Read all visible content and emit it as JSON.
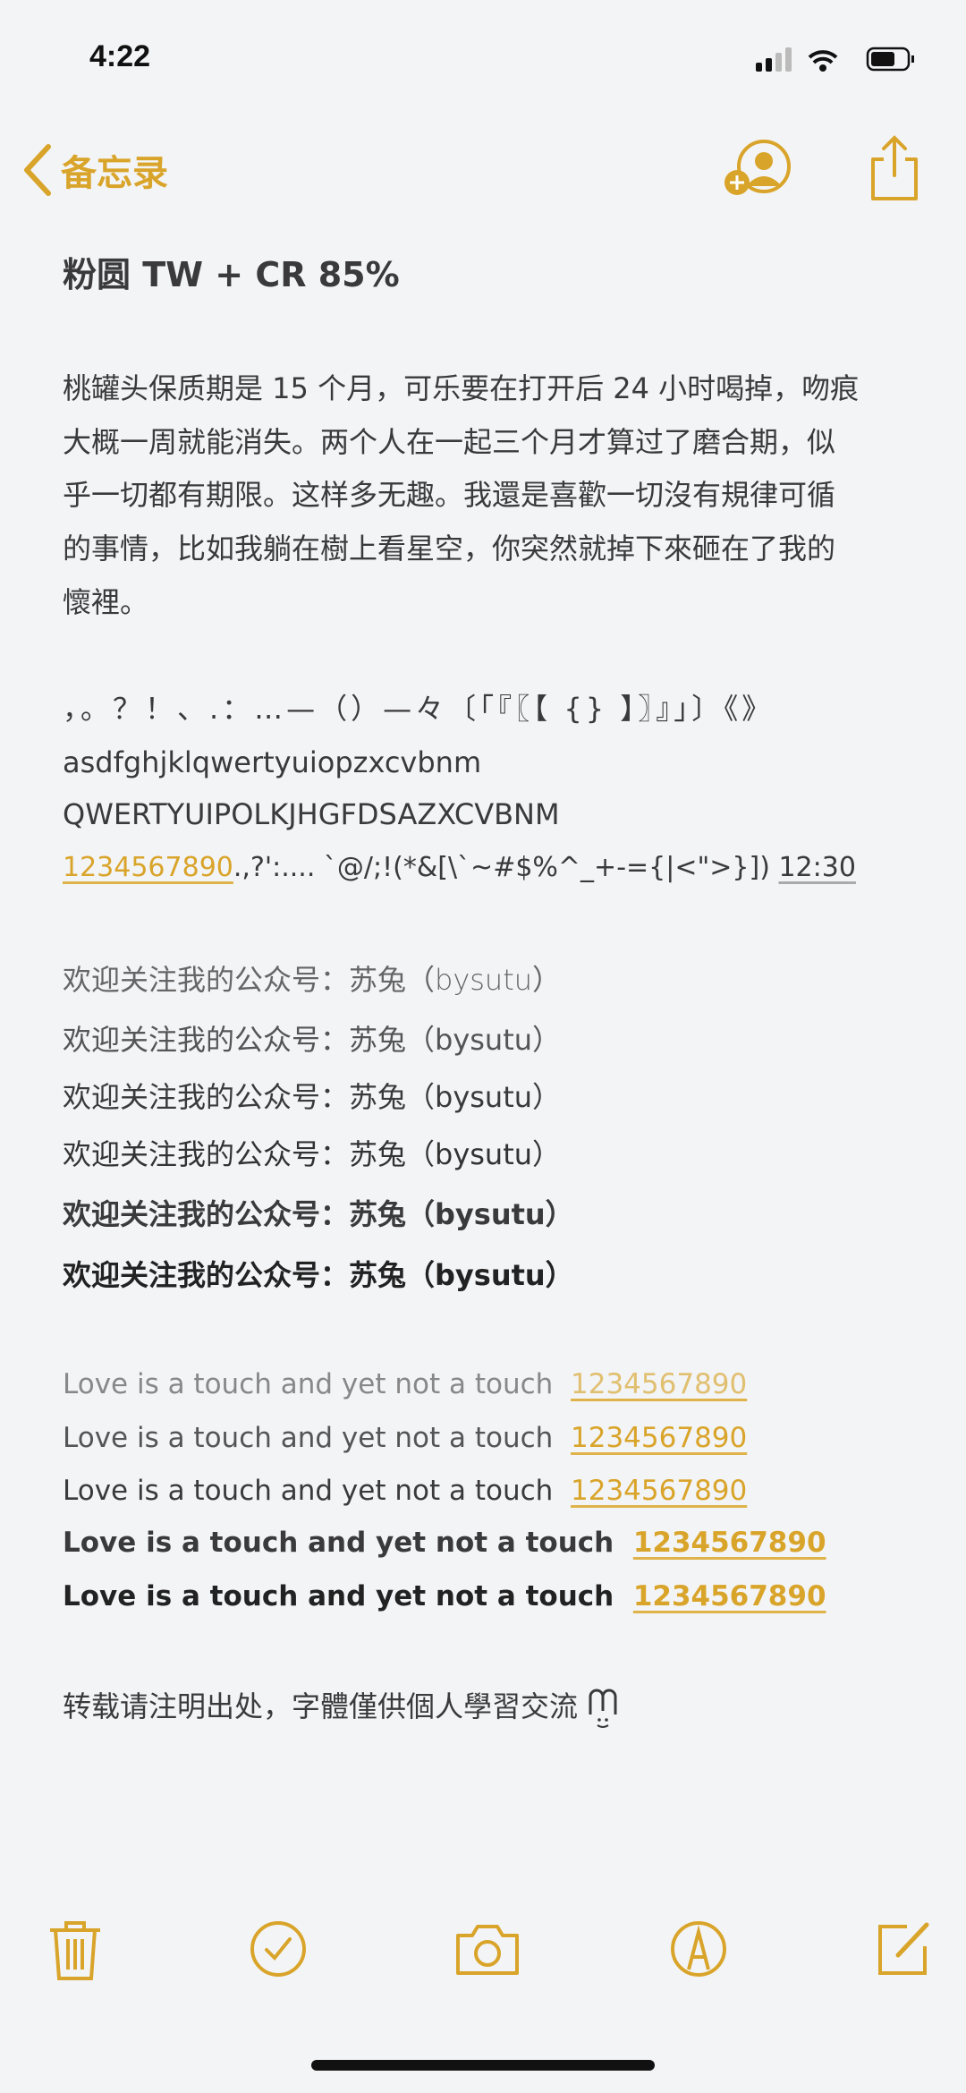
{
  "status_bar": {
    "time": "4:22"
  },
  "nav": {
    "back_label": "备忘录",
    "icons": [
      "chevron-left-icon",
      "add-person-icon",
      "share-icon"
    ]
  },
  "note": {
    "title": "粉圆 TW + CR 85%",
    "paragraph": [
      "桃罐头保质期是 15 个月，可乐要在打开后 24 小时喝掉，吻痕",
      "大概一周就能消失。两个人在一起三个月才算过了磨合期，似",
      "乎一切都有期限。这样多无趣。我還是喜歡一切沒有規律可循",
      "的事情，比如我躺在樹上看星空，你突然就掉下來砸在了我的",
      "懷裡。"
    ],
    "punctuation": "，。？！、.：…—（）—々〔「『〖【 {} 】〗』」〕《》",
    "lowercase": "asdfghjklqwertyuiopzxcvbnm",
    "uppercase": "QWERTYUIPOLKJHGFDSAZXCVBNM",
    "digits_link": "1234567890",
    "symbols": ".,?':.... `@/;!(*&[\\`~#$%^_+-={|<\">}]) ",
    "time_link": "12:30",
    "welcome_lines": [
      "欢迎关注我的公众号：苏兔（bysutu）",
      "欢迎关注我的公众号：苏兔（bysutu）",
      "欢迎关注我的公众号：苏兔（bysutu）",
      "欢迎关注我的公众号：苏兔（bysutu）",
      "欢迎关注我的公众号：苏兔（bysutu）",
      "欢迎关注我的公众号：苏兔（bysutu）"
    ],
    "love_lines": [
      {
        "text": "Love is a touch and yet not a touch",
        "number": "1234567890"
      },
      {
        "text": "Love is a touch and yet not a touch",
        "number": "1234567890"
      },
      {
        "text": "Love is a touch and yet not a touch",
        "number": "1234567890"
      },
      {
        "text": "Love is a touch and yet not a touch",
        "number": "1234567890"
      },
      {
        "text": "Love is a touch and yet not a touch",
        "number": "1234567890"
      }
    ],
    "footer": "转载请注明出处，字體僅供個人學習交流"
  },
  "toolbar": {
    "icons": [
      "trash-icon",
      "checklist-icon",
      "camera-icon",
      "markup-icon",
      "compose-icon"
    ]
  },
  "colors": {
    "accent": "#d9a42a",
    "text": "#3a3a3c",
    "background": "#f3f4f6"
  }
}
